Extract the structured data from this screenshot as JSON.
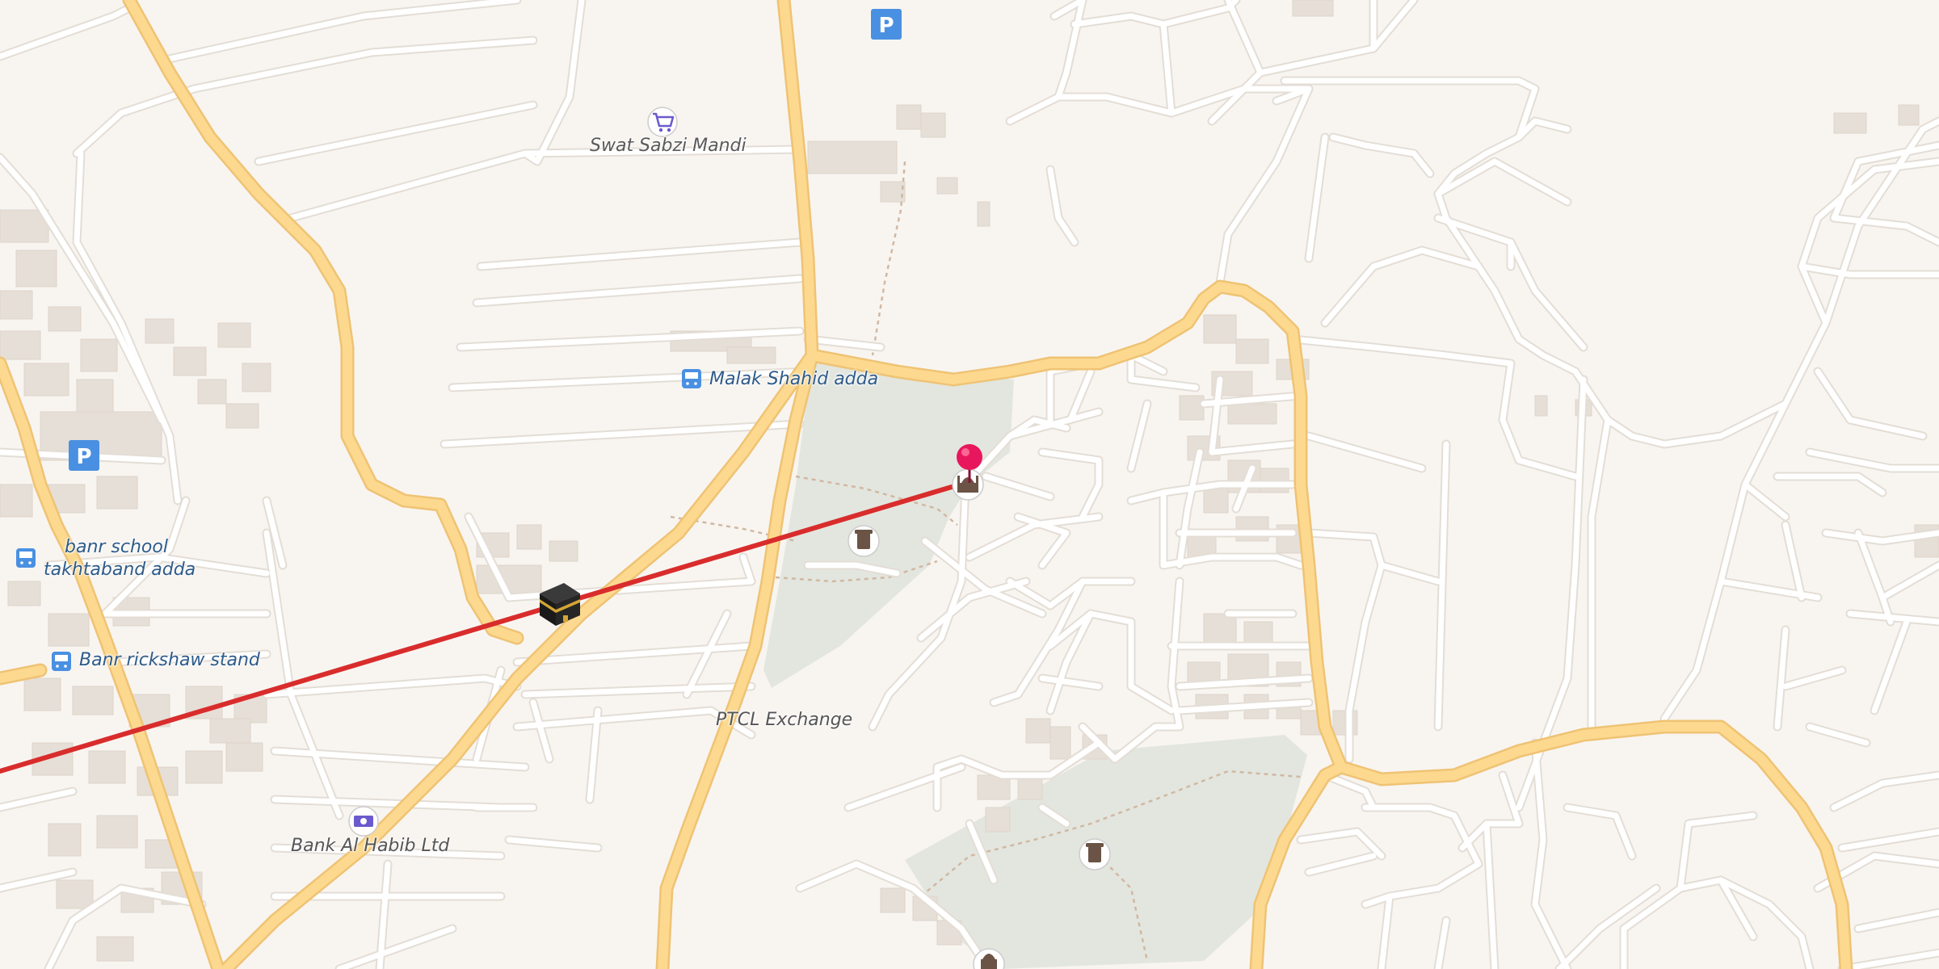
{
  "map": {
    "kind": "street-map",
    "colors": {
      "background": "#f8f5f1",
      "minor_road": "#ffffff",
      "minor_road_casing": "#e3ddd5",
      "primary_road": "#fcd98f",
      "primary_road_casing": "#efc374",
      "park": "#e3e6df",
      "building": "#e6dfd7",
      "path": "#d1b8a2",
      "route_line": "#d92c2c",
      "pin": "#e8175d",
      "bus_icon": "#4a90e2",
      "parking": "#4a90e2"
    },
    "labels": {
      "swat_sabzi_mandi": "Swat Sabzi Mandi",
      "malak_shahid_adda": "Malak Shahid adda",
      "banr_school_line1": "banr school",
      "banr_school_line2": "takhtaband adda",
      "banr_rickshaw_stand": "Banr rickshaw stand",
      "ptcl_exchange": "PTCL Exchange",
      "bank_al_habib": "Bank Al Habib Ltd",
      "parking_symbol": "P"
    },
    "icons": {
      "kaaba": "kaaba-icon",
      "pin": "location-pin-icon",
      "mosque": "mosque-icon",
      "grave_1": "grave-icon",
      "grave_2": "grave-icon",
      "shop": "shopping-cart-icon",
      "bus": "bus-icon",
      "bank": "bank-note-icon",
      "parking": "parking-icon"
    }
  }
}
